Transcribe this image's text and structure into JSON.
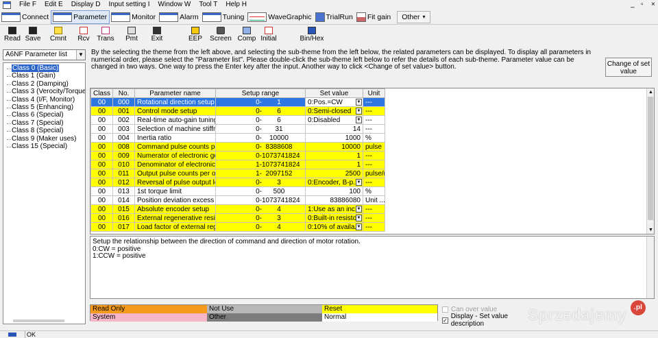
{
  "menu": [
    "File F",
    "Edit E",
    "Display D",
    "Input setting I",
    "Window W",
    "Tool T",
    "Help H"
  ],
  "window_controls": {
    "minimize": "_",
    "restore": "▫",
    "close": "×"
  },
  "tabs": [
    {
      "label": "Connect",
      "icon": "connect-icon"
    },
    {
      "label": "Parameter",
      "icon": "parameter-icon",
      "active": true
    },
    {
      "label": "Monitor",
      "icon": "monitor-icon"
    },
    {
      "label": "Alarm",
      "icon": "alarm-icon"
    },
    {
      "label": "Tuning",
      "icon": "tuning-icon"
    },
    {
      "label": "WaveGraphic",
      "icon": "wavegraphic-icon"
    },
    {
      "label": "TrialRun",
      "icon": "trialrun-icon"
    },
    {
      "label": "Fit gain",
      "icon": "fitgain-icon"
    }
  ],
  "other_button": "Other",
  "other_arrow": "▾",
  "toolbar": {
    "read": "Read",
    "save": "Save",
    "cmnt": "Cmnt",
    "rcv": "Rcv",
    "trans": "Trans",
    "pmt": "Pmt",
    "exit": "Exit",
    "eep": "EEP",
    "screen": "Screen",
    "comp": "Comp",
    "initial": "Initial",
    "binhex": "Bin/Hex"
  },
  "param_list": {
    "selected": "A6NF Parameter list",
    "arrow": "▼"
  },
  "tree_items": [
    "Class 0 (Basic)",
    "Class 1 (Gain)",
    "Class 2 (Damping)",
    "Class 3 (Verocity/Torque/Fu",
    "Class 4 (I/F, Monitor)",
    "Class 5 (Enhancing)",
    "Class 6 (Special)",
    "Class 7 (Special)",
    "Class 8 (Special)",
    "Class 9 (Maker uses)",
    "Class 15 (Special)"
  ],
  "description": "By the selecting the theme from the left above, and selecting the sub-theme from the left below, the related parameters can be displayed. To display all parameters in numerical order, please select the \"Parameter list\". Please double-click the sub-theme left below to refer the details of each sub-theme. Parameter value can be changed in two ways. One way to press the Enter key after the input. Another way to click <Change of set value> button.",
  "change_button": "Change of set value",
  "table": {
    "headers": [
      "Class",
      "No.",
      "Parameter name",
      "Setup range",
      "Set value",
      "Unit"
    ],
    "rows": [
      {
        "cls": "00",
        "no": "000",
        "name": "Rotational direction setup",
        "rmin": "0-",
        "rmax": "1",
        "val": "0:Pos.=CW",
        "dd": true,
        "unit": "---",
        "style": "blue"
      },
      {
        "cls": "00",
        "no": "001",
        "name": "Control mode setup",
        "rmin": "0-",
        "rmax": "6",
        "val": "0:Semi-closed",
        "dd": true,
        "unit": "---",
        "style": "yellow"
      },
      {
        "cls": "00",
        "no": "002",
        "name": "Real-time auto-gain tuning s...",
        "rmin": "0-",
        "rmax": "6",
        "val": "0:Disabled",
        "dd": true,
        "unit": "---",
        "style": "white"
      },
      {
        "cls": "00",
        "no": "003",
        "name": "Selection of machine stiffnes...",
        "rmin": "0-",
        "rmax": "31",
        "val": "14",
        "dd": false,
        "unit": "---",
        "style": "white"
      },
      {
        "cls": "00",
        "no": "004",
        "name": "Inertia ratio",
        "rmin": "0-",
        "rmax": "10000",
        "val": "1000",
        "dd": false,
        "unit": "%",
        "style": "white"
      },
      {
        "cls": "00",
        "no": "008",
        "name": "Command pulse counts per ...",
        "rmin": "0-",
        "rmax": "8388608",
        "val": "10000",
        "dd": false,
        "unit": "pulse",
        "style": "yellow"
      },
      {
        "cls": "00",
        "no": "009",
        "name": "Numerator of electronic gear",
        "rmin": "0-",
        "rmax": "1073741824",
        "val": "1",
        "dd": false,
        "unit": "---",
        "style": "yellow"
      },
      {
        "cls": "00",
        "no": "010",
        "name": "Denominator of electronic ge...",
        "rmin": "1-",
        "rmax": "1073741824",
        "val": "1",
        "dd": false,
        "unit": "---",
        "style": "yellow"
      },
      {
        "cls": "00",
        "no": "011",
        "name": "Output pulse counts per one ...",
        "rmin": "1-",
        "rmax": "2097152",
        "val": "2500",
        "dd": false,
        "unit": "pulse/r",
        "style": "yellow"
      },
      {
        "cls": "00",
        "no": "012",
        "name": "Reversal of pulse output logi...",
        "rmin": "0-",
        "rmax": "3",
        "val": "0:Encoder, B-p...",
        "dd": true,
        "unit": "---",
        "style": "yellow"
      },
      {
        "cls": "00",
        "no": "013",
        "name": "1st torque limit",
        "rmin": "0-",
        "rmax": "500",
        "val": "100",
        "dd": false,
        "unit": "%",
        "style": "white"
      },
      {
        "cls": "00",
        "no": "014",
        "name": "Position deviation excess se...",
        "rmin": "0-",
        "rmax": "1073741824",
        "val": "83886080",
        "dd": false,
        "unit": "Unit ...",
        "style": "white"
      },
      {
        "cls": "00",
        "no": "015",
        "name": "Absolute encoder setup",
        "rmin": "0-",
        "rmax": "4",
        "val": "1:Use as an inc...",
        "dd": true,
        "unit": "---",
        "style": "yellow"
      },
      {
        "cls": "00",
        "no": "016",
        "name": "External regenerative resisto...",
        "rmin": "0-",
        "rmax": "3",
        "val": "0:Built-in resisto...",
        "dd": true,
        "unit": "---",
        "style": "yellow"
      },
      {
        "cls": "00",
        "no": "017",
        "name": "Load factor of external regen...",
        "rmin": "0-",
        "rmax": "4",
        "val": "0:10% of availa...",
        "dd": true,
        "unit": "---",
        "style": "yellow"
      }
    ]
  },
  "detail_lines": [
    "Setup the relationship between the direction of command and direction of motor rotation.",
    "0:CW = positive",
    "1:CCW = positive"
  ],
  "legend": [
    {
      "label": "Read Only",
      "color": "#f59a1c"
    },
    {
      "label": "Not Use",
      "color": "#b8b8b8"
    },
    {
      "label": "Reset",
      "color": "#ffff00"
    },
    {
      "label": "System",
      "color": "#f7b5c8"
    },
    {
      "label": "Other",
      "color": "#7c7c7c"
    },
    {
      "label": "Normal",
      "color": "#ffffff"
    }
  ],
  "options": [
    {
      "label": "Can over value",
      "checked": false,
      "enabled": false
    },
    {
      "label": "Display - Set value description",
      "checked": true,
      "enabled": true
    }
  ],
  "watermark": {
    "text": "Sprzedajemy",
    "badge": ".pl"
  },
  "status": "OK"
}
